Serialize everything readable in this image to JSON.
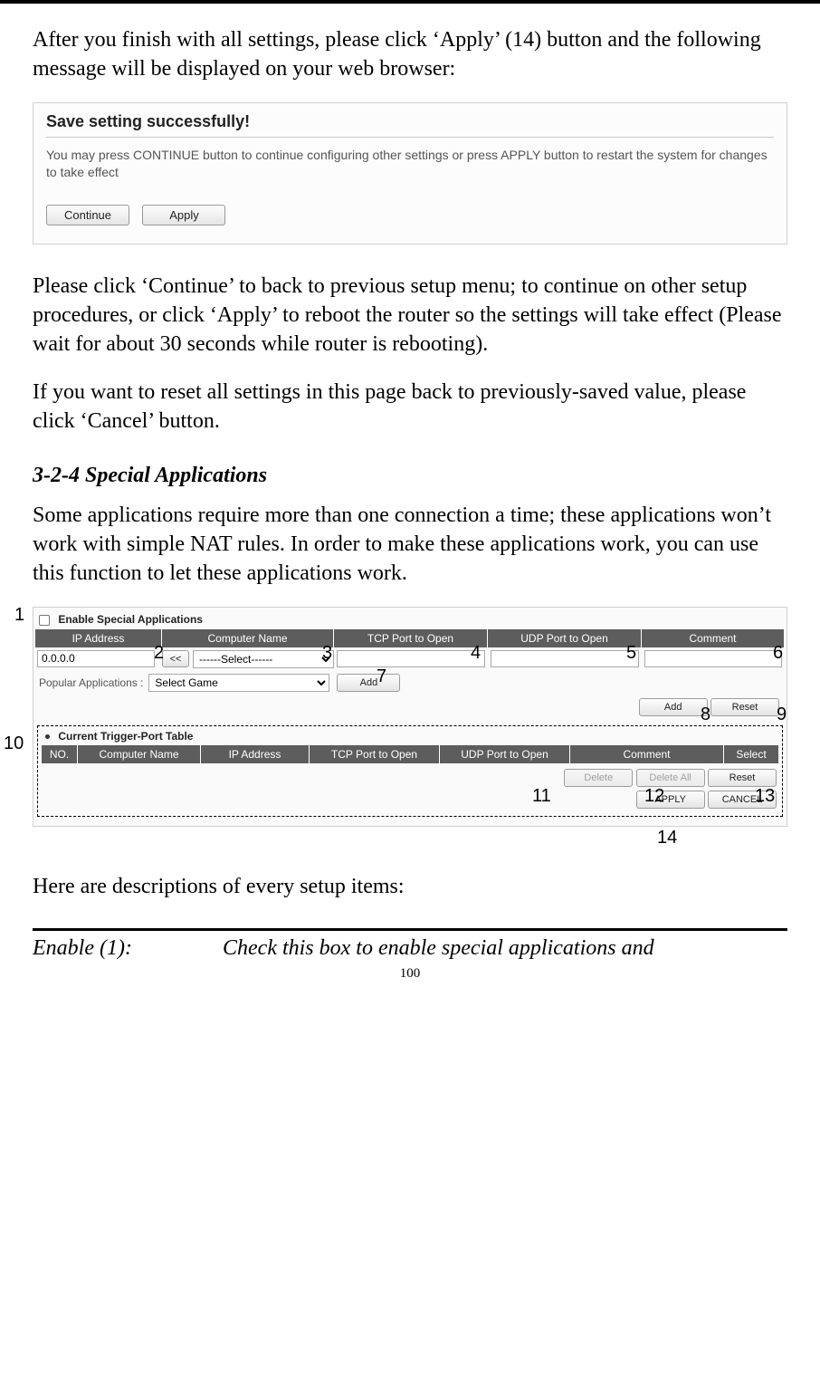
{
  "para1": "After you finish with all settings, please click ‘Apply’ (14) button and the following message will be displayed on your web browser:",
  "ss1": {
    "title": "Save setting successfully!",
    "desc": "You may press CONTINUE button to continue configuring other settings or press APPLY button to restart the system for changes to take effect",
    "continue_btn": "Continue",
    "apply_btn": "Apply"
  },
  "para2": "Please click ‘Continue’ to back to previous setup menu; to continue on other setup procedures, or click ‘Apply’ to reboot the router so the settings will take effect (Please wait for about 30 seconds while router is rebooting).",
  "para3": "If you want to reset all settings in this page back to previously-saved value, please click ‘Cancel’ button.",
  "section_title": "3-2-4 Special Applications",
  "para4": "Some applications require more than one connection a time; these applications won’t work with simple NAT rules. In order to make these applications work, you can use this function to let these applications work.",
  "ss2": {
    "enable_label": "Enable Special Applications",
    "hdr": {
      "ip": "IP Address",
      "cn": "Computer Name",
      "tcp": "TCP Port to Open",
      "udp": "UDP Port to Open",
      "com": "Comment"
    },
    "ip_value": "0.0.0.0",
    "ll_btn": "<<",
    "select_placeholder": "------Select------",
    "pop_label": "Popular Applications :",
    "pop_value": "Select Game",
    "add_btn": "Add",
    "reset_btn": "Reset",
    "cur_title": "Current Trigger-Port Table",
    "hdr2": {
      "no": "NO.",
      "cn": "Computer Name",
      "ip": "IP Address",
      "tcp": "TCP Port to Open",
      "udp": "UDP Port to Open",
      "com": "Comment",
      "sel": "Select"
    },
    "delete_btn": "Delete",
    "delete_all_btn": "Delete All",
    "reset2_btn": "Reset",
    "apply_btn": "APPLY",
    "cancel_btn": "CANCEL"
  },
  "callouts": {
    "c1": "1",
    "c2": "2",
    "c3": "3",
    "c4": "4",
    "c5": "5",
    "c6": "6",
    "c7": "7",
    "c8": "8",
    "c9": "9",
    "c10": "10",
    "c11": "11",
    "c12": "12",
    "c13": "13",
    "c14": "14"
  },
  "para5": "Here are descriptions of every setup items:",
  "def_term": "Enable (1):",
  "def_desc": "Check this box to enable special applications and",
  "page_number": "100"
}
